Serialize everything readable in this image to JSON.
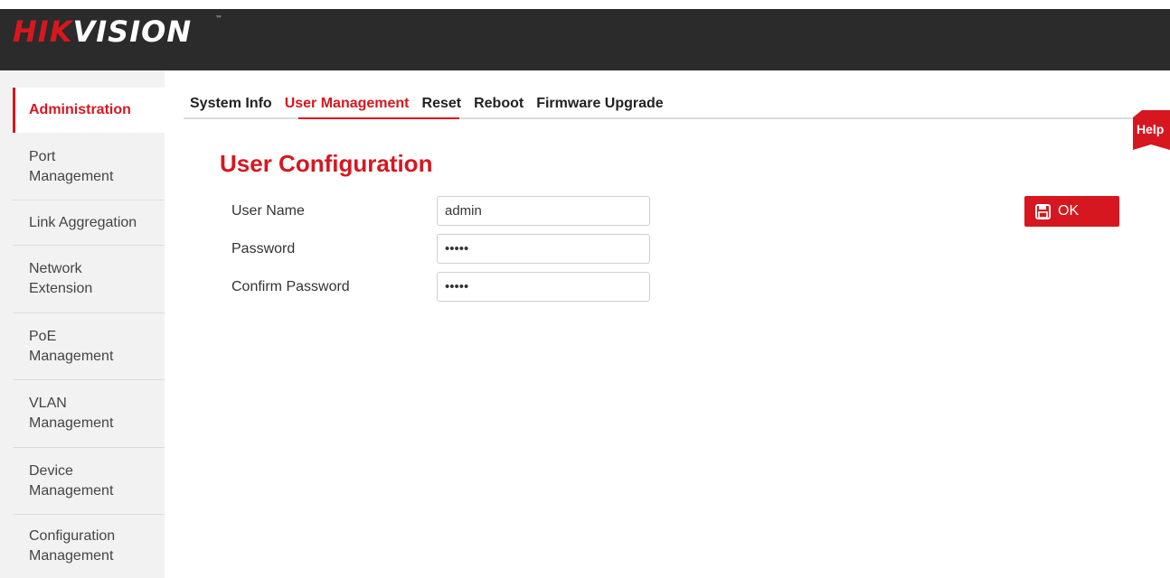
{
  "brand": {
    "part1": "HIK",
    "part2": "VISION",
    "tm": "™"
  },
  "sidebar": {
    "items": [
      {
        "label": "Administration",
        "active": true
      },
      {
        "label": "Port\nManagement"
      },
      {
        "label": "Link Aggregation"
      },
      {
        "label": "Network\nExtension"
      },
      {
        "label": "PoE\nManagement"
      },
      {
        "label": "VLAN\nManagement"
      },
      {
        "label": "Device\nManagement"
      },
      {
        "label": "Configuration\nManagement"
      }
    ]
  },
  "tabs": [
    {
      "label": "System Info"
    },
    {
      "label": "User Management",
      "active": true
    },
    {
      "label": "Reset"
    },
    {
      "label": "Reboot"
    },
    {
      "label": "Firmware Upgrade"
    }
  ],
  "help": {
    "label": "Help"
  },
  "section": {
    "title": "User Configuration"
  },
  "form": {
    "user_name": {
      "label": "User Name",
      "value": "admin"
    },
    "password": {
      "label": "Password",
      "value": "•••••"
    },
    "confirm_password": {
      "label": "Confirm Password",
      "value": "•••••"
    }
  },
  "actions": {
    "ok_label": "OK",
    "ok_icon": "save-icon"
  },
  "colors": {
    "accent": "#d7171f",
    "header": "#2b2b2b",
    "sidebar": "#f2f2f2"
  }
}
